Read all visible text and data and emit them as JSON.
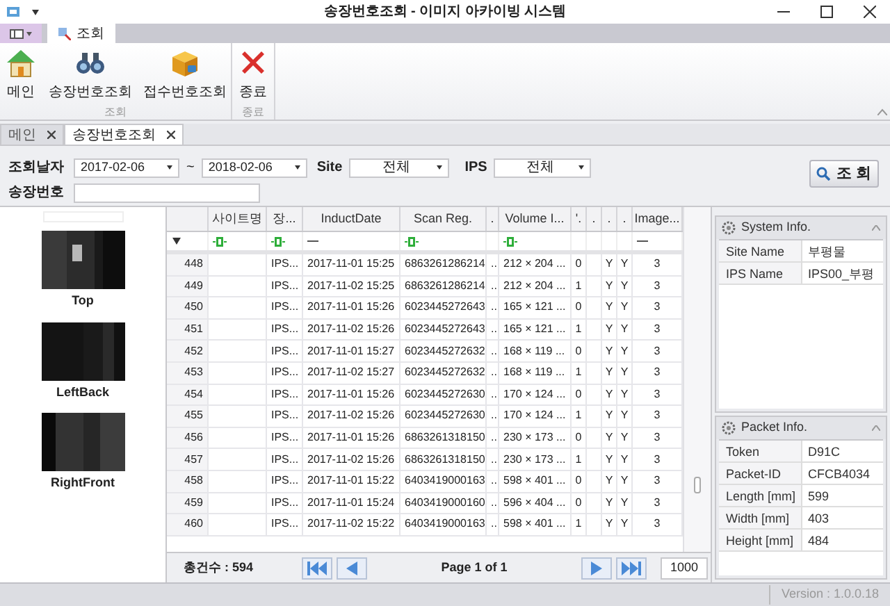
{
  "window": {
    "title": "송장번호조회 - 이미지 아카이빙 시스템"
  },
  "ribbon_tabs": [
    {
      "kind": "menu",
      "selected": false
    },
    {
      "label": "조회",
      "kind": "tab",
      "selected": true
    }
  ],
  "ribbon_groups": [
    {
      "label": "조회",
      "buttons": [
        {
          "label": "메인",
          "kind": "home"
        },
        {
          "label": "송장번호조회",
          "kind": "binoculars"
        },
        {
          "label": "접수번호조회",
          "kind": "box"
        }
      ]
    },
    {
      "label": "종료",
      "buttons": [
        {
          "label": "종료",
          "kind": "exit"
        }
      ]
    }
  ],
  "doc_tabs": [
    {
      "label": "메인",
      "selected": false
    },
    {
      "label": "송장번호조회",
      "selected": true
    }
  ],
  "filters": {
    "date_label": "조회날자",
    "date_from": "2017-02-06",
    "date_sep": "~",
    "date_to": "2018-02-06",
    "site_label": "Site",
    "site_value": "전체",
    "ips_label": "IPS",
    "ips_value": "전체",
    "invoice_label": "송장번호",
    "search_button": "조 회"
  },
  "images": [
    {
      "label": "Top"
    },
    {
      "label": "LeftBack"
    },
    {
      "label": "RightFront"
    }
  ],
  "table": {
    "columns": [
      "",
      "사이트명",
      "장...",
      "InductDate",
      "Scan Reg.",
      ".",
      "Volume I...",
      "'.",
      ".",
      ".",
      ".",
      "Image..."
    ],
    "filter_row": [
      {
        "kind": "menu"
      },
      {
        "kind": "contains"
      },
      {
        "kind": "contains"
      },
      {
        "kind": "equals"
      },
      {
        "kind": "contains"
      },
      {
        "kind": "none"
      },
      {
        "kind": "contains"
      },
      {
        "kind": "none"
      },
      {
        "kind": "none"
      },
      {
        "kind": "none"
      },
      {
        "kind": "none"
      },
      {
        "kind": "equals"
      }
    ],
    "rows": [
      [
        "448",
        "",
        "IPS...",
        "2017-11-01 15:25",
        "6863261286214",
        "..",
        "212 × 204 ...",
        "0",
        "",
        "Y",
        "Y",
        "3"
      ],
      [
        "449",
        "",
        "IPS...",
        "2017-11-02 15:25",
        "6863261286214",
        "..",
        "212 × 204 ...",
        "1",
        "",
        "Y",
        "Y",
        "3"
      ],
      [
        "450",
        "",
        "IPS...",
        "2017-11-01 15:26",
        "6023445272643",
        "..",
        "165 × 121 ...",
        "0",
        "",
        "Y",
        "Y",
        "3"
      ],
      [
        "451",
        "",
        "IPS...",
        "2017-11-02 15:26",
        "6023445272643",
        "..",
        "165 × 121 ...",
        "1",
        "",
        "Y",
        "Y",
        "3"
      ],
      [
        "452",
        "",
        "IPS...",
        "2017-11-01 15:27",
        "6023445272632",
        "..",
        "168 × 119 ...",
        "0",
        "",
        "Y",
        "Y",
        "3"
      ],
      [
        "453",
        "",
        "IPS...",
        "2017-11-02 15:27",
        "6023445272632",
        "..",
        "168 × 119 ...",
        "1",
        "",
        "Y",
        "Y",
        "3"
      ],
      [
        "454",
        "",
        "IPS...",
        "2017-11-01 15:26",
        "6023445272630",
        "..",
        "170 × 124 ...",
        "0",
        "",
        "Y",
        "Y",
        "3"
      ],
      [
        "455",
        "",
        "IPS...",
        "2017-11-02 15:26",
        "6023445272630",
        "..",
        "170 × 124 ...",
        "1",
        "",
        "Y",
        "Y",
        "3"
      ],
      [
        "456",
        "",
        "IPS...",
        "2017-11-01 15:26",
        "6863261318150",
        "..",
        "230 × 173 ...",
        "0",
        "",
        "Y",
        "Y",
        "3"
      ],
      [
        "457",
        "",
        "IPS...",
        "2017-11-02 15:26",
        "6863261318150",
        "..",
        "230 × 173 ...",
        "1",
        "",
        "Y",
        "Y",
        "3"
      ],
      [
        "458",
        "",
        "IPS...",
        "2017-11-01 15:22",
        "6403419000163",
        "..",
        "598 × 401 ...",
        "0",
        "",
        "Y",
        "Y",
        "3"
      ],
      [
        "459",
        "",
        "IPS...",
        "2017-11-01 15:24",
        "6403419000160",
        "..",
        "596 × 404 ...",
        "0",
        "",
        "Y",
        "Y",
        "3"
      ],
      [
        "460",
        "",
        "IPS...",
        "2017-11-02 15:22",
        "6403419000163",
        "..",
        "598 × 401 ...",
        "1",
        "",
        "Y",
        "Y",
        "3"
      ]
    ]
  },
  "pager": {
    "total": "총건수 : 594",
    "page": "Page 1 of 1",
    "page_size": "1000"
  },
  "system_info": {
    "title": "System Info.",
    "rows": [
      [
        "Site Name",
        "부평물"
      ],
      [
        "IPS Name",
        "IPS00_부평"
      ]
    ]
  },
  "packet_info": {
    "title": "Packet Info.",
    "rows": [
      [
        "Token",
        "D91C"
      ],
      [
        "Packet-ID",
        "CFCB4034"
      ],
      [
        "Length [mm]",
        "599"
      ],
      [
        "Width [mm]",
        "403"
      ],
      [
        "Height [mm]",
        "484"
      ]
    ]
  },
  "status_bar": {
    "version": "Version : 1.0.0.18"
  }
}
